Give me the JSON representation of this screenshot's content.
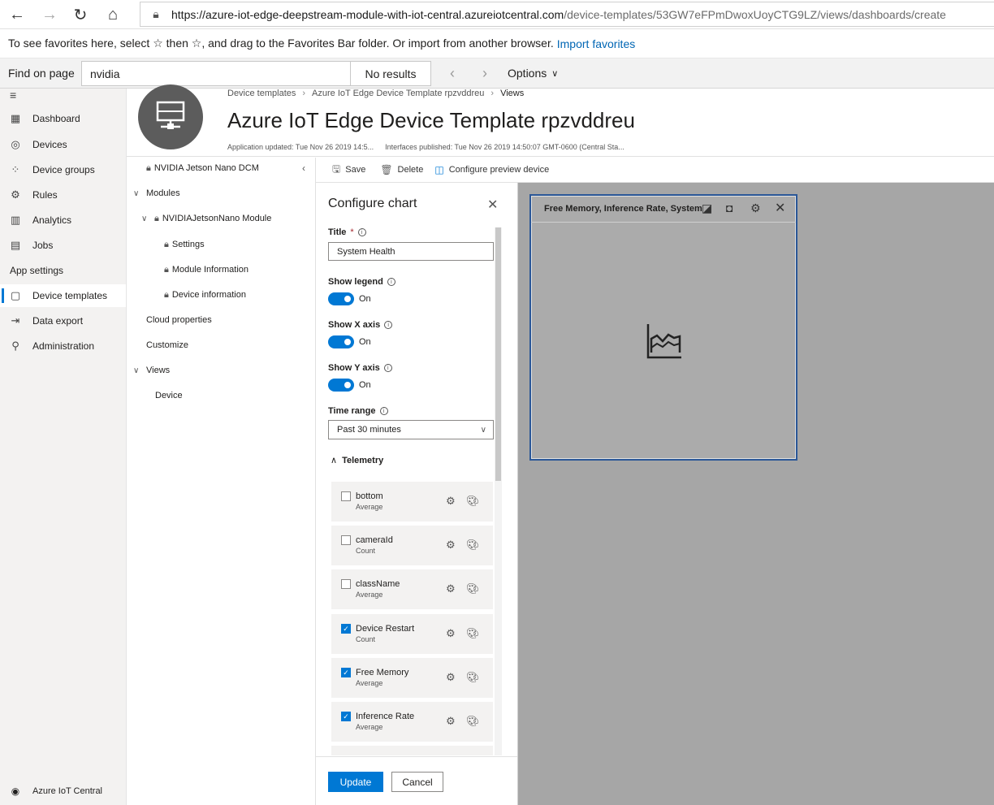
{
  "browser": {
    "url_domain": "https://azure-iot-edge-deepstream-module-with-iot-central.azureiotcentral.com",
    "url_path": "/device-templates/53GW7eFPmDwoxUoyCTG9LZ/views/dashboards/create",
    "favorites_text": "To see favorites here, select ☆ then ☆, and drag to the Favorites Bar folder. Or import from another browser.",
    "favorites_link": "Import favorites"
  },
  "find": {
    "label": "Find on page",
    "query": "nvidia",
    "results": "No results",
    "options": "Options"
  },
  "nav": {
    "items": [
      {
        "label": "Dashboard",
        "icon": "▦"
      },
      {
        "label": "Devices",
        "icon": "◎"
      },
      {
        "label": "Device groups",
        "icon": "⁘"
      },
      {
        "label": "Rules",
        "icon": "⚙"
      },
      {
        "label": "Analytics",
        "icon": "▥"
      },
      {
        "label": "Jobs",
        "icon": "▤"
      }
    ],
    "section": "App settings",
    "app_items": [
      {
        "label": "Device templates",
        "icon": "▢"
      },
      {
        "label": "Data export",
        "icon": "⇥"
      },
      {
        "label": "Administration",
        "icon": "⚲"
      }
    ],
    "bottom": "Azure IoT Central"
  },
  "header": {
    "breadcrumb": [
      "Device templates",
      "Azure IoT Edge Device Template rpzvddreu",
      "Views"
    ],
    "title": "Azure IoT Edge Device Template rpzvddreu",
    "app_updated": "Application updated: Tue Nov 26 2019 14:5...",
    "interfaces_published": "Interfaces published: Tue Nov 26 2019 14:50:07 GMT-0600 (Central Sta..."
  },
  "tree": {
    "root": "NVIDIA Jetson Nano DCM",
    "modules": "Modules",
    "module": "NVIDIAJetsonNano Module",
    "settings": "Settings",
    "module_info": "Module Information",
    "device_info": "Device information",
    "cloud_props": "Cloud properties",
    "customize": "Customize",
    "views": "Views",
    "device": "Device"
  },
  "toolbar": {
    "save": "Save",
    "delete": "Delete",
    "configure": "Configure preview device"
  },
  "config": {
    "title": "Configure chart",
    "title_label": "Title",
    "title_value": "System Health",
    "show_legend": "Show legend",
    "show_x": "Show X axis",
    "show_y": "Show Y axis",
    "on": "On",
    "time_range": "Time range",
    "time_value": "Past 30 minutes",
    "telemetry": "Telemetry",
    "items": [
      {
        "name": "bottom",
        "agg": "Average",
        "checked": false
      },
      {
        "name": "cameraId",
        "agg": "Count",
        "checked": false
      },
      {
        "name": "className",
        "agg": "Average",
        "checked": false
      },
      {
        "name": "Device Restart",
        "agg": "Count",
        "checked": true
      },
      {
        "name": "Free Memory",
        "agg": "Average",
        "checked": true
      },
      {
        "name": "Inference Rate",
        "agg": "Average",
        "checked": true
      }
    ],
    "update": "Update",
    "cancel": "Cancel"
  },
  "tile": {
    "title": "Free Memory, Inference Rate, System"
  }
}
